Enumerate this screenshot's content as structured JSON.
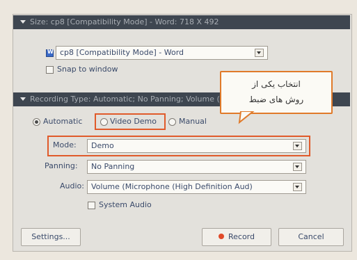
{
  "size_section": {
    "header": "Size: cp8 [Compatibility Mode] - Word: 718 X 492",
    "window_select": "cp8 [Compatibility Mode] - Word",
    "snap_label": "Snap to window"
  },
  "recording_section": {
    "header": "Recording Type: Automatic; No Panning; Volume (Microphone (High...",
    "automatic_label": "Automatic",
    "video_demo_label": "Video Demo",
    "manual_label": "Manual",
    "mode_label": "Mode:",
    "mode_value": "Demo",
    "panning_label": "Panning:",
    "panning_value": "No Panning",
    "audio_label": "Audio:",
    "audio_value": "Volume (Microphone (High Definition Aud)",
    "system_audio_label": "System Audio"
  },
  "callout": {
    "line1": "انتخاب یکی از",
    "line2": "روش های ضبط"
  },
  "buttons": {
    "settings": "Settings...",
    "record": "Record",
    "cancel": "Cancel"
  },
  "colors": {
    "accent": "#e05a2a",
    "header_bg": "#3e4650"
  }
}
